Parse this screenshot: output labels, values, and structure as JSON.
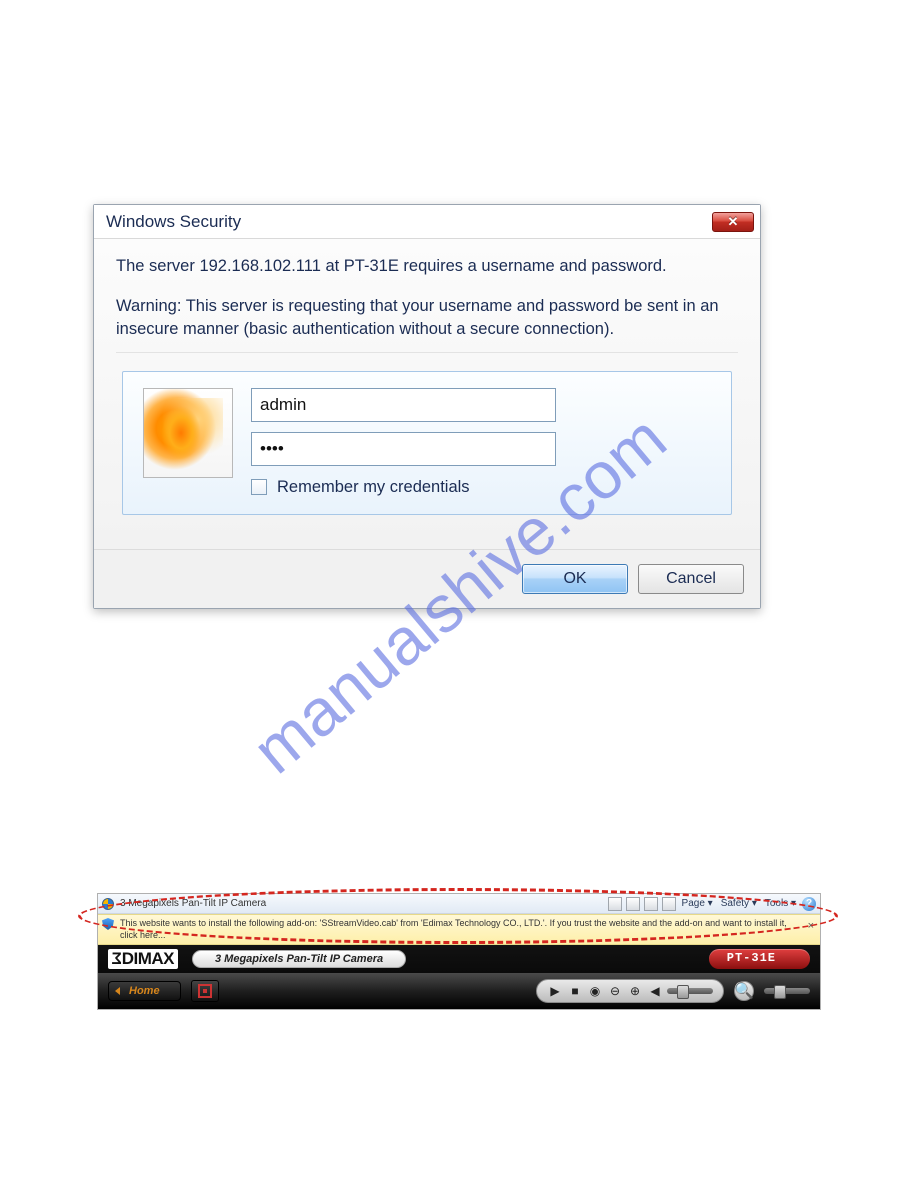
{
  "watermark": "manualshive.com",
  "dialog": {
    "title": "Windows Security",
    "message1": "The server 192.168.102.111 at PT-31E requires a username and password.",
    "message2": "Warning: This server is requesting that your username and password be sent in an insecure manner (basic authentication without a secure connection).",
    "username": "admin",
    "password": "••••",
    "remember_label": "Remember my credentials",
    "ok_label": "OK",
    "cancel_label": "Cancel",
    "close_glyph": "✕"
  },
  "ie": {
    "tab_title": "3 Megapixels Pan-Tilt IP Camera",
    "menu": {
      "page": "Page ▾",
      "safety": "Safety ▾",
      "tools": "Tools ▾",
      "help": "?"
    },
    "infobar": "This website wants to install the following add-on: 'SStreamVideo.cab' from 'Edimax Technology CO., LTD.'. If you trust the website and the add-on and want to install it, click here...",
    "close_x": "×"
  },
  "camera": {
    "brand": "DIMAX",
    "brand_prefix": "Σ",
    "title_pill": "3 Megapixels Pan-Tilt IP Camera",
    "model": "PT-31E",
    "home_label": "Home",
    "controls": {
      "play": "▶",
      "stop": "■",
      "snapshot": "◉",
      "zoom_out": "⊖",
      "zoom_in": "⊕",
      "volume": "◀",
      "search": "🔍"
    }
  }
}
